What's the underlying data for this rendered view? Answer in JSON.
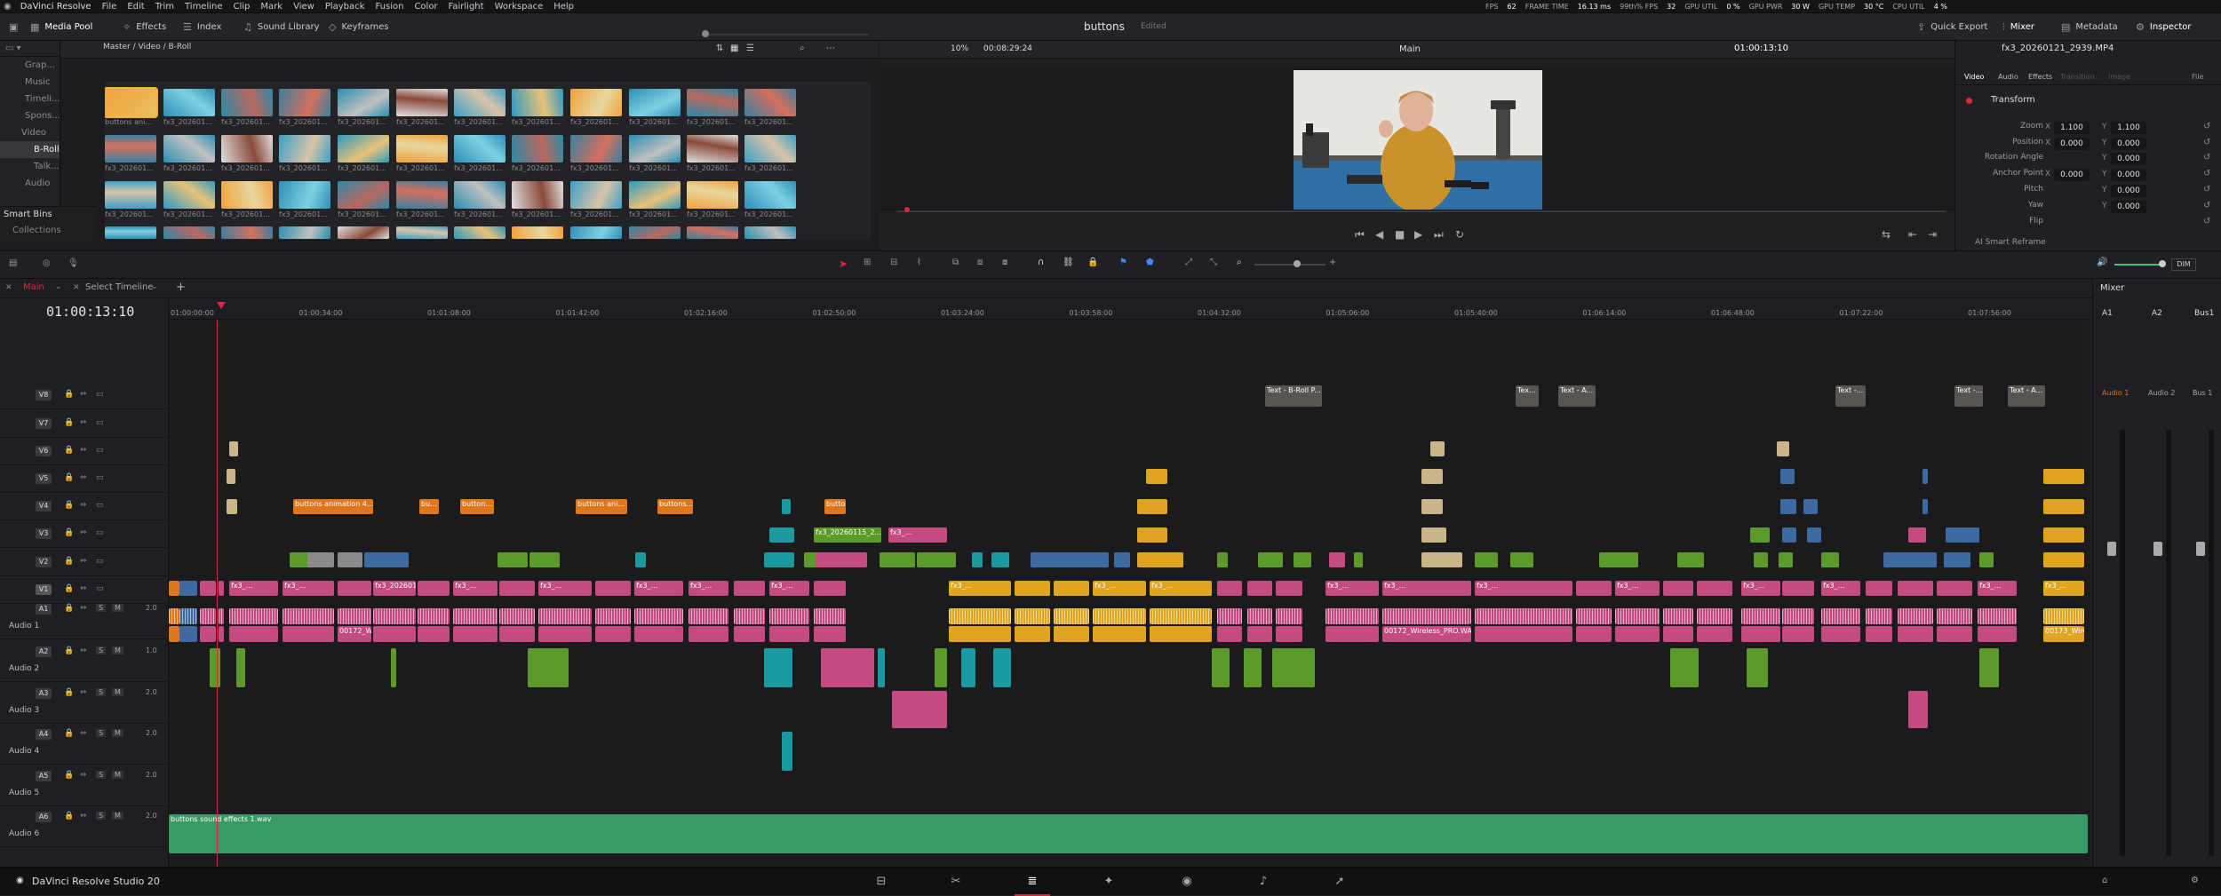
{
  "app": {
    "name": "DaVinci Resolve",
    "footer": "DaVinci Resolve Studio 20"
  },
  "menu": [
    "File",
    "Edit",
    "Trim",
    "Timeline",
    "Clip",
    "Mark",
    "View",
    "Playback",
    "Fusion",
    "Color",
    "Fairlight",
    "Workspace",
    "Help"
  ],
  "perf": [
    "FPS",
    "62",
    "FRAME TIME",
    "16.13 ms",
    "99th% FPS",
    "32",
    "GPU UTIL",
    "0 %",
    "GPU PWR",
    "30 W",
    "GPU TEMP",
    "30 °C",
    "CPU UTIL",
    "4 %"
  ],
  "toolbar": {
    "left": [
      "Media Pool",
      "Effects",
      "Index",
      "Sound Library",
      "Keyframes"
    ],
    "project": "buttons",
    "status": "Edited",
    "right": [
      "Quick Export",
      "Mixer",
      "Metadata",
      "Inspector"
    ]
  },
  "bins": {
    "items": [
      "Grap...",
      "Music",
      "Timeli...",
      "Spons...",
      "Video",
      "B-Roll",
      "Talk...",
      "Audio"
    ],
    "selected": "B-Roll",
    "smart": "Smart Bins",
    "collections": "Collections"
  },
  "media": {
    "path": "Master / Video / B-Roll",
    "labels": [
      "buttons ani...",
      "fx3_202601...",
      "fx3_202601...",
      "fx3_202601...",
      "fx3_202601...",
      "fx3_202601...",
      "fx3_202601...",
      "fx3_202601...",
      "fx3_202601...",
      "fx3_202601...",
      "fx3_202601...",
      "fx3_202601...",
      "fx3_202601...",
      "fx3_202601...",
      "fx3_202601...",
      "fx3_202601...",
      "fx3_202601...",
      "fx3_202601...",
      "fx3_202601...",
      "fx3_202601...",
      "fx3_202601...",
      "fx3_202601...",
      "fx3_202601...",
      "fx3_202601...",
      "fx3_202601...",
      "fx3_202601...",
      "fx3_202601...",
      "fx3_202601...",
      "fx3_202601...",
      "fx3_202601...",
      "fx3_202601...",
      "fx3_202601...",
      "fx3_202601...",
      "fx3_202601...",
      "fx3_202601...",
      "fx3_202601..."
    ]
  },
  "viewer": {
    "zoom": "10%",
    "duration": "00:08:29:24",
    "timeline": "Main",
    "timecode": "01:00:13:10",
    "clip": "fx3_20260121_2939.MP4"
  },
  "inspector": {
    "tabs": [
      "Video",
      "Audio",
      "Effects",
      "Transition",
      "Image",
      "File"
    ],
    "section": "Transform",
    "rows": [
      {
        "label": "Zoom",
        "x": "1.100",
        "y": "1.100"
      },
      {
        "label": "Position",
        "x": "0.000",
        "y": "0.000"
      },
      {
        "label": "Rotation Angle",
        "x": "",
        "y": "0.000"
      },
      {
        "label": "Anchor Point",
        "x": "0.000",
        "y": "0.000"
      },
      {
        "label": "Pitch",
        "x": "",
        "y": "0.000"
      },
      {
        "label": "Yaw",
        "x": "",
        "y": "0.000"
      },
      {
        "label": "Flip",
        "x": "",
        "y": ""
      }
    ],
    "smart": "AI Smart Reframe"
  },
  "timeline": {
    "tab": "Main",
    "select": "Select Timeline",
    "timecode": "01:00:13:10",
    "ruler": [
      "01:00:00:00",
      "01:00:34:00",
      "01:01:08:00",
      "01:01:42:00",
      "01:02:16:00",
      "01:02:50:00",
      "01:03:24:00",
      "01:03:58:00",
      "01:04:32:00",
      "01:05:06:00",
      "01:05:40:00",
      "01:06:14:00",
      "01:06:48:00",
      "01:07:22:00",
      "01:07:56:00"
    ],
    "video_tracks": [
      "V8",
      "V7",
      "V6",
      "V5",
      "V4",
      "V3",
      "V2",
      "V1"
    ],
    "audio_tracks": [
      {
        "id": "A1",
        "name": "Audio 1",
        "level": "2.0"
      },
      {
        "id": "A2",
        "name": "Audio 2",
        "level": "1.0"
      },
      {
        "id": "A3",
        "name": "Audio 3",
        "level": "2.0"
      },
      {
        "id": "A4",
        "name": "Audio 4",
        "level": "2.0"
      },
      {
        "id": "A5",
        "name": "Audio 5",
        "level": "2.0"
      },
      {
        "id": "A6",
        "name": "Audio 6",
        "level": "2.0"
      }
    ],
    "clip_labels": {
      "v4": [
        "buttons animation 4...",
        "bu...",
        "button...",
        "buttons ani...",
        "buttons..."
      ],
      "v3": [
        "fx3_20260115_2...",
        "fx3_..."
      ],
      "text": [
        "Text - B-Roll P...",
        "Tex...",
        "Text - A...",
        "Text -...",
        "Text -...",
        "Text - A..."
      ],
      "a1": [
        "fx3_20260121_2939...",
        "fx3_20260121_2939.MP4"
      ],
      "a1b": [
        "00172_Wireles...",
        "00172_Wireless_PRO.WAV",
        "00173_Wireles..."
      ],
      "a6": "buttons sound effects 1.wav"
    }
  },
  "mixer": {
    "title": "Mixer",
    "channels": [
      "A1",
      "A2",
      "Bus1"
    ],
    "names": [
      "Audio 1",
      "Audio 2",
      "Bus 1"
    ],
    "dim": "DIM"
  },
  "pages": [
    "media",
    "cut",
    "edit",
    "fusion",
    "color",
    "fairlight",
    "deliver"
  ],
  "colors": {
    "accent": "#e0273a",
    "pink": "#c44a7f",
    "orange": "#e0761a",
    "yellow": "#e0a520",
    "green": "#5c9a2a",
    "teal": "#1a9a9e",
    "blue": "#3d6aa0",
    "tan": "#c9b58a",
    "a6": "#3a9a66"
  }
}
